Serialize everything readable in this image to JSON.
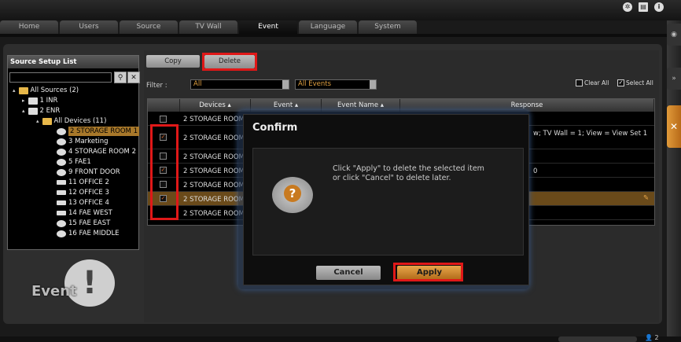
{
  "tabs": [
    "Home",
    "Users",
    "Source",
    "TV Wall",
    "Event",
    "Language",
    "System"
  ],
  "active_tab": "Event",
  "source_list": {
    "title": "Source Setup List",
    "search_placeholder": "",
    "tree": [
      {
        "label": "All Sources (2)",
        "type": "folder"
      },
      {
        "label": "1 INR",
        "type": "server"
      },
      {
        "label": "2 ENR",
        "type": "server"
      },
      {
        "label": "All Devices (11)",
        "type": "folder"
      },
      {
        "label": "2 STORAGE ROOM 1",
        "type": "dome",
        "selected": true
      },
      {
        "label": "3 Marketing",
        "type": "dome"
      },
      {
        "label": "4 STORAGE ROOM 2",
        "type": "dome"
      },
      {
        "label": "5 FAE1",
        "type": "dome"
      },
      {
        "label": "9 FRONT DOOR",
        "type": "dome"
      },
      {
        "label": "11 OFFICE 2",
        "type": "bullet"
      },
      {
        "label": "12 OFFICE 3",
        "type": "bullet"
      },
      {
        "label": "13 OFFICE 4",
        "type": "bullet"
      },
      {
        "label": "14 FAE WEST",
        "type": "bullet"
      },
      {
        "label": "15 FAE EAST",
        "type": "dome"
      },
      {
        "label": "16 FAE MIDDLE",
        "type": "dome"
      }
    ]
  },
  "toolbar": {
    "copy_label": "Copy",
    "delete_label": "Delete"
  },
  "filter": {
    "label": "Filter :",
    "device_value": "All",
    "event_value": "All Events",
    "clear_all": "Clear All",
    "select_all": "Select All"
  },
  "table": {
    "headers": [
      "Devices",
      "Event",
      "Event Name",
      "Response"
    ],
    "rows": [
      {
        "device": "2 STORAGE ROOM",
        "checked": false,
        "response": "",
        "highlight": false
      },
      {
        "device": "2 STORAGE ROOM",
        "checked": true,
        "response": "w; TV Wall = 1; View = View Set 1",
        "highlight": false
      },
      {
        "device": "2 STORAGE ROOM",
        "checked": false,
        "response": "",
        "highlight": false
      },
      {
        "device": "2 STORAGE ROOM",
        "checked": true,
        "response": "0",
        "highlight": false
      },
      {
        "device": "2 STORAGE ROOM",
        "checked": false,
        "response": "",
        "highlight": false
      },
      {
        "device": "2 STORAGE ROOM",
        "checked": true,
        "response": "",
        "highlight": true
      },
      {
        "device": "2 STORAGE ROOM",
        "checked": false,
        "response": "",
        "highlight": false
      }
    ]
  },
  "dialog": {
    "title": "Confirm",
    "message_line1": "Click \"Apply\" to delete the selected item",
    "message_line2": "or click \"Cancel\" to delete later.",
    "cancel_label": "Cancel",
    "apply_label": "Apply"
  },
  "event_watermark": "Event",
  "footer_count": "2",
  "colors": {
    "accent": "#e8a64a",
    "highlight_box": "#e01818",
    "selected_row": "#6a4a1a"
  }
}
